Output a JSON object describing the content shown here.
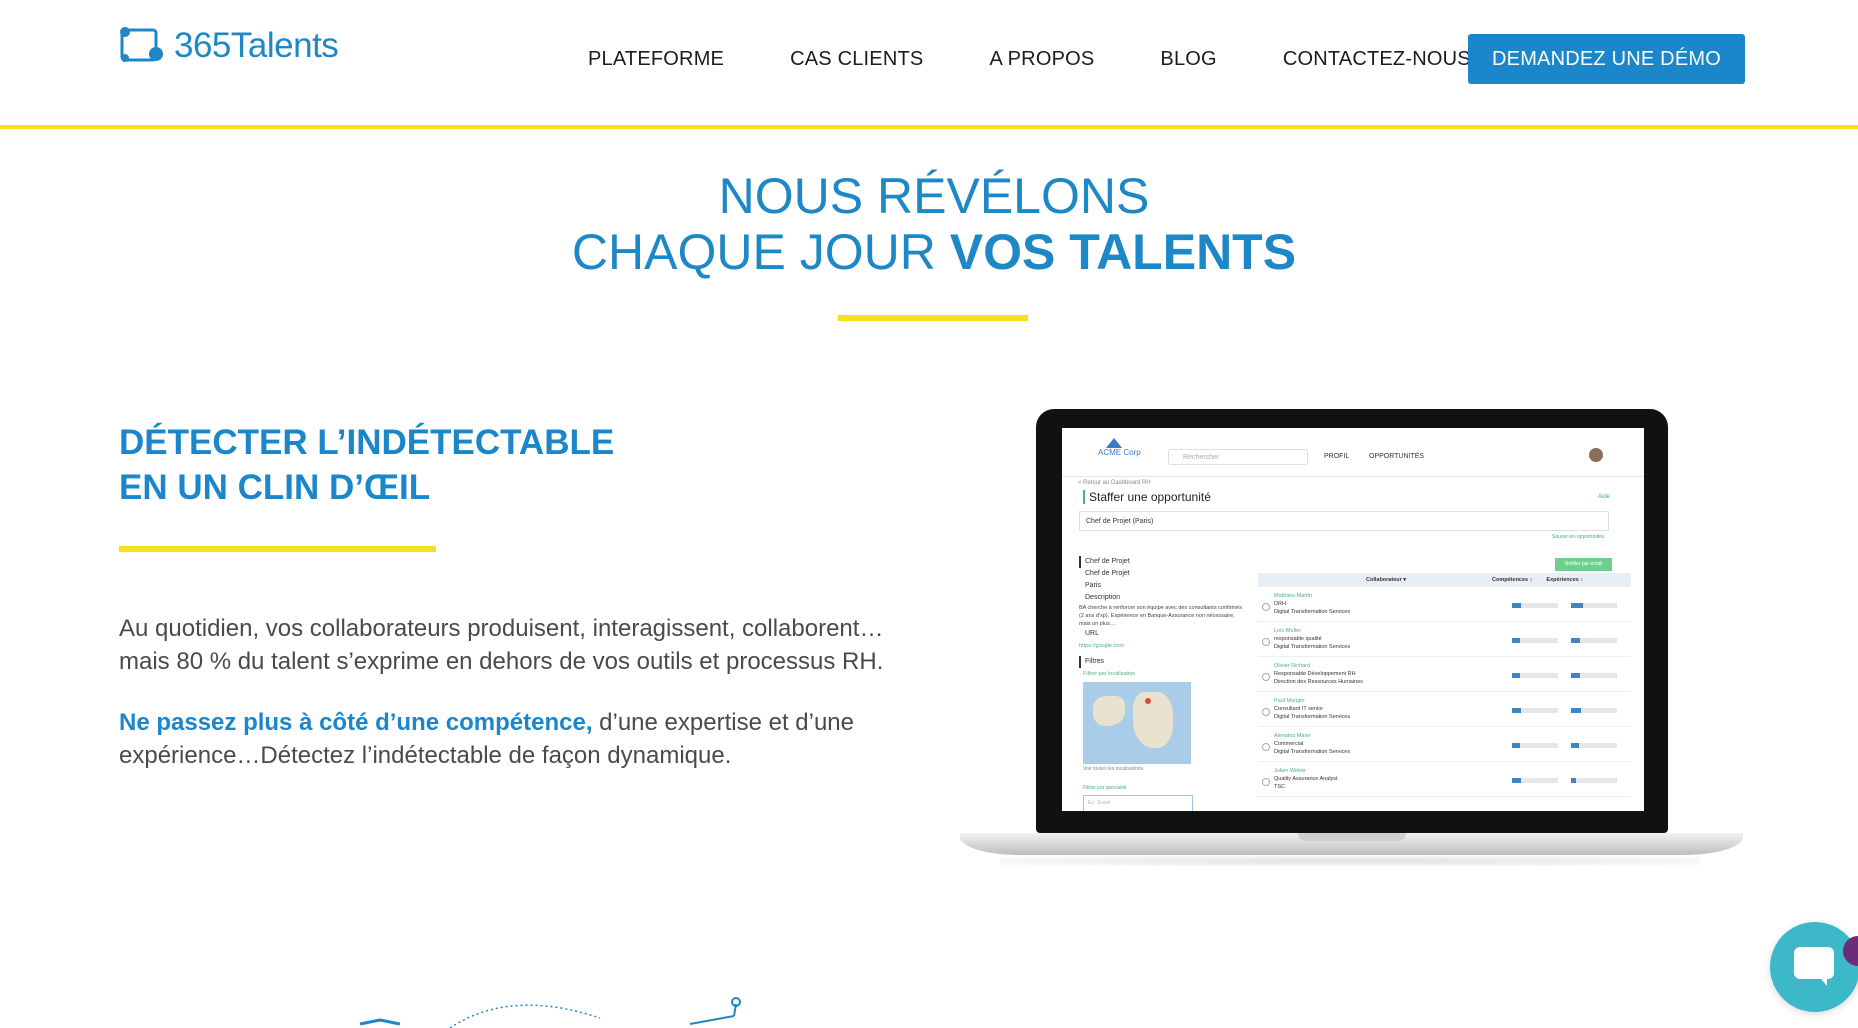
{
  "header": {
    "logo_text": "365Talents",
    "nav": [
      "PLATEFORME",
      "CAS CLIENTS",
      "A PROPOS",
      "BLOG",
      "CONTACTEZ-NOUS"
    ],
    "cta": "DEMANDEZ UNE DÉMO"
  },
  "hero": {
    "line1": "NOUS RÉVÉLONS",
    "line2_light": "CHAQUE JOUR",
    "line2_bold": "VOS TALENTS"
  },
  "feature": {
    "title_line1": "DÉTECTER L’INDÉTECTABLE",
    "title_line2": "EN UN CLIN D’ŒIL",
    "paragraph1": "Au quotidien, vos collaborateurs produisent, interagissent, collaborent… mais 80 % du talent s’exprime en dehors de vos outils et processus RH.",
    "paragraph2_highlight": "Ne passez plus à côté d’une compétence,",
    "paragraph2_rest": " d’une expertise et d’une expérience…Détectez l’indétectable de façon dynamique."
  },
  "screen": {
    "brand": "ACME Corp",
    "search_placeholder": "Rechercher",
    "nav": [
      "PROFIL",
      "OPPORTUNITÉS"
    ],
    "back_link": "« Retour au Dashboard RH",
    "title": "Staffer une opportunité",
    "help": "Aide",
    "input_value": "Chef de Projet (Paris)",
    "save_link": "Sauver les opportunités",
    "notify_button": "Notifier par email",
    "left_panel": {
      "heading": "Chef de Projet",
      "items": [
        "Chef de Projet",
        "Paris",
        "Description"
      ],
      "description": "BA cherche à renforcer son équipe avec des consultants confirmés (2 ans d’xp). Expérience en Banque-Assurance non nécessaire, mais un plus…",
      "url_label": "URL",
      "url_value": "https://google.com",
      "filters_label": "Filtres",
      "filter_location": "Filtrer par localisation",
      "show_all": "Voir toutes les localisations",
      "filter_specialty": "Filtrer par spécialité",
      "specialty_placeholder": "Ex : Excel"
    },
    "table": {
      "headers": [
        "Collaborateur ▾",
        "Compétences ↕",
        "Expériences ↕"
      ],
      "rows": [
        {
          "name": "Matthieu Martin",
          "role": "DRH",
          "dept": "Digital Transformation Services",
          "competences": 0.2,
          "experiences": 0.25
        },
        {
          "name": "Loïc Muller",
          "role": "responsable qualité",
          "dept": "Digital Transformation Services",
          "competences": 0.18,
          "experiences": 0.2
        },
        {
          "name": "Olivier Richard",
          "role": "Responsable Développement RH",
          "dept": "Direction des Ressources Humaines",
          "competences": 0.18,
          "experiences": 0.2
        },
        {
          "name": "Paul Mougin",
          "role": "Consultant IT senior",
          "dept": "Digital Transformation Services",
          "competences": 0.2,
          "experiences": 0.22
        },
        {
          "name": "Alexatou Marie",
          "role": "Commercial",
          "dept": "Digital Transformation Services",
          "competences": 0.18,
          "experiences": 0.18
        },
        {
          "name": "Julien Weber",
          "role": "Quality Assurance Analyst",
          "dept": "TSC",
          "competences": 0.2,
          "experiences": 0.1
        }
      ]
    }
  },
  "colors": {
    "brand_blue": "#1b86c9",
    "accent_yellow": "#f5e21b",
    "chat_teal": "#3db8c9"
  }
}
